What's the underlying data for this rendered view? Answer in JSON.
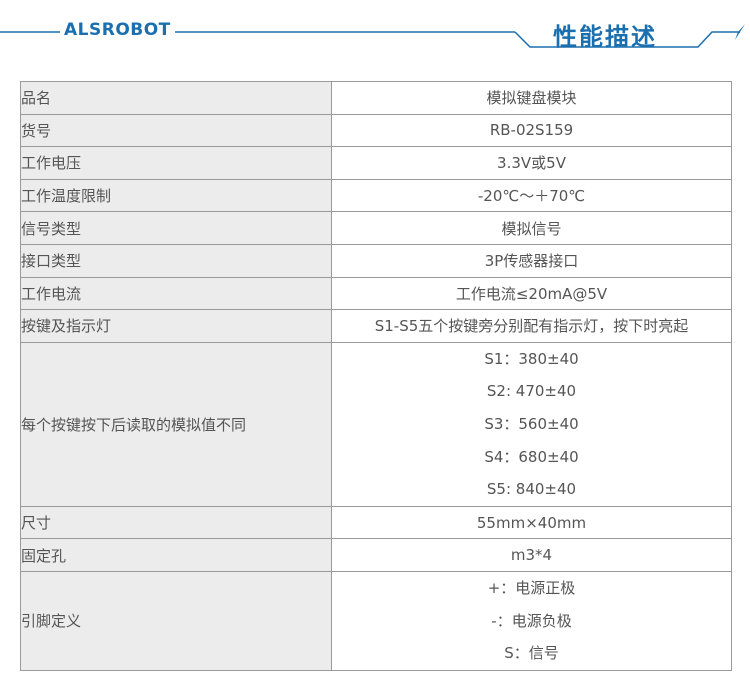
{
  "header": {
    "brand": "ALSROBOT",
    "section_title": "性能描述"
  },
  "colors": {
    "accent": "#1b6fae",
    "label_bg": "#ececec",
    "border": "#9a9a9a"
  },
  "rows": [
    {
      "label": "品名",
      "value": "模拟键盘模块"
    },
    {
      "label": "货号",
      "value": "RB-02S159"
    },
    {
      "label": "工作电压",
      "value": "3.3V或5V"
    },
    {
      "label": "工作温度限制",
      "value": "-20℃～＋70℃"
    },
    {
      "label": "信号类型",
      "value": "模拟信号"
    },
    {
      "label": "接口类型",
      "value": "3P传感器接口"
    },
    {
      "label": "工作电流",
      "value": "工作电流≤20mA@5V"
    },
    {
      "label": "按键及指示灯",
      "value": "S1-S5五个按键旁分别配有指示灯，按下时亮起"
    },
    {
      "label": "每个按键按下后读取的模拟值不同",
      "values": [
        "S1：380±40",
        "S2: 470±40",
        "S3：560±40",
        "S4：680±40",
        "S5: 840±40"
      ]
    },
    {
      "label": "尺寸",
      "value": "55mm×40mm"
    },
    {
      "label": "固定孔",
      "value": "m3*4"
    },
    {
      "label": "引脚定义",
      "values": [
        "+：电源正极",
        "-：电源负极",
        "S：信号"
      ]
    }
  ]
}
